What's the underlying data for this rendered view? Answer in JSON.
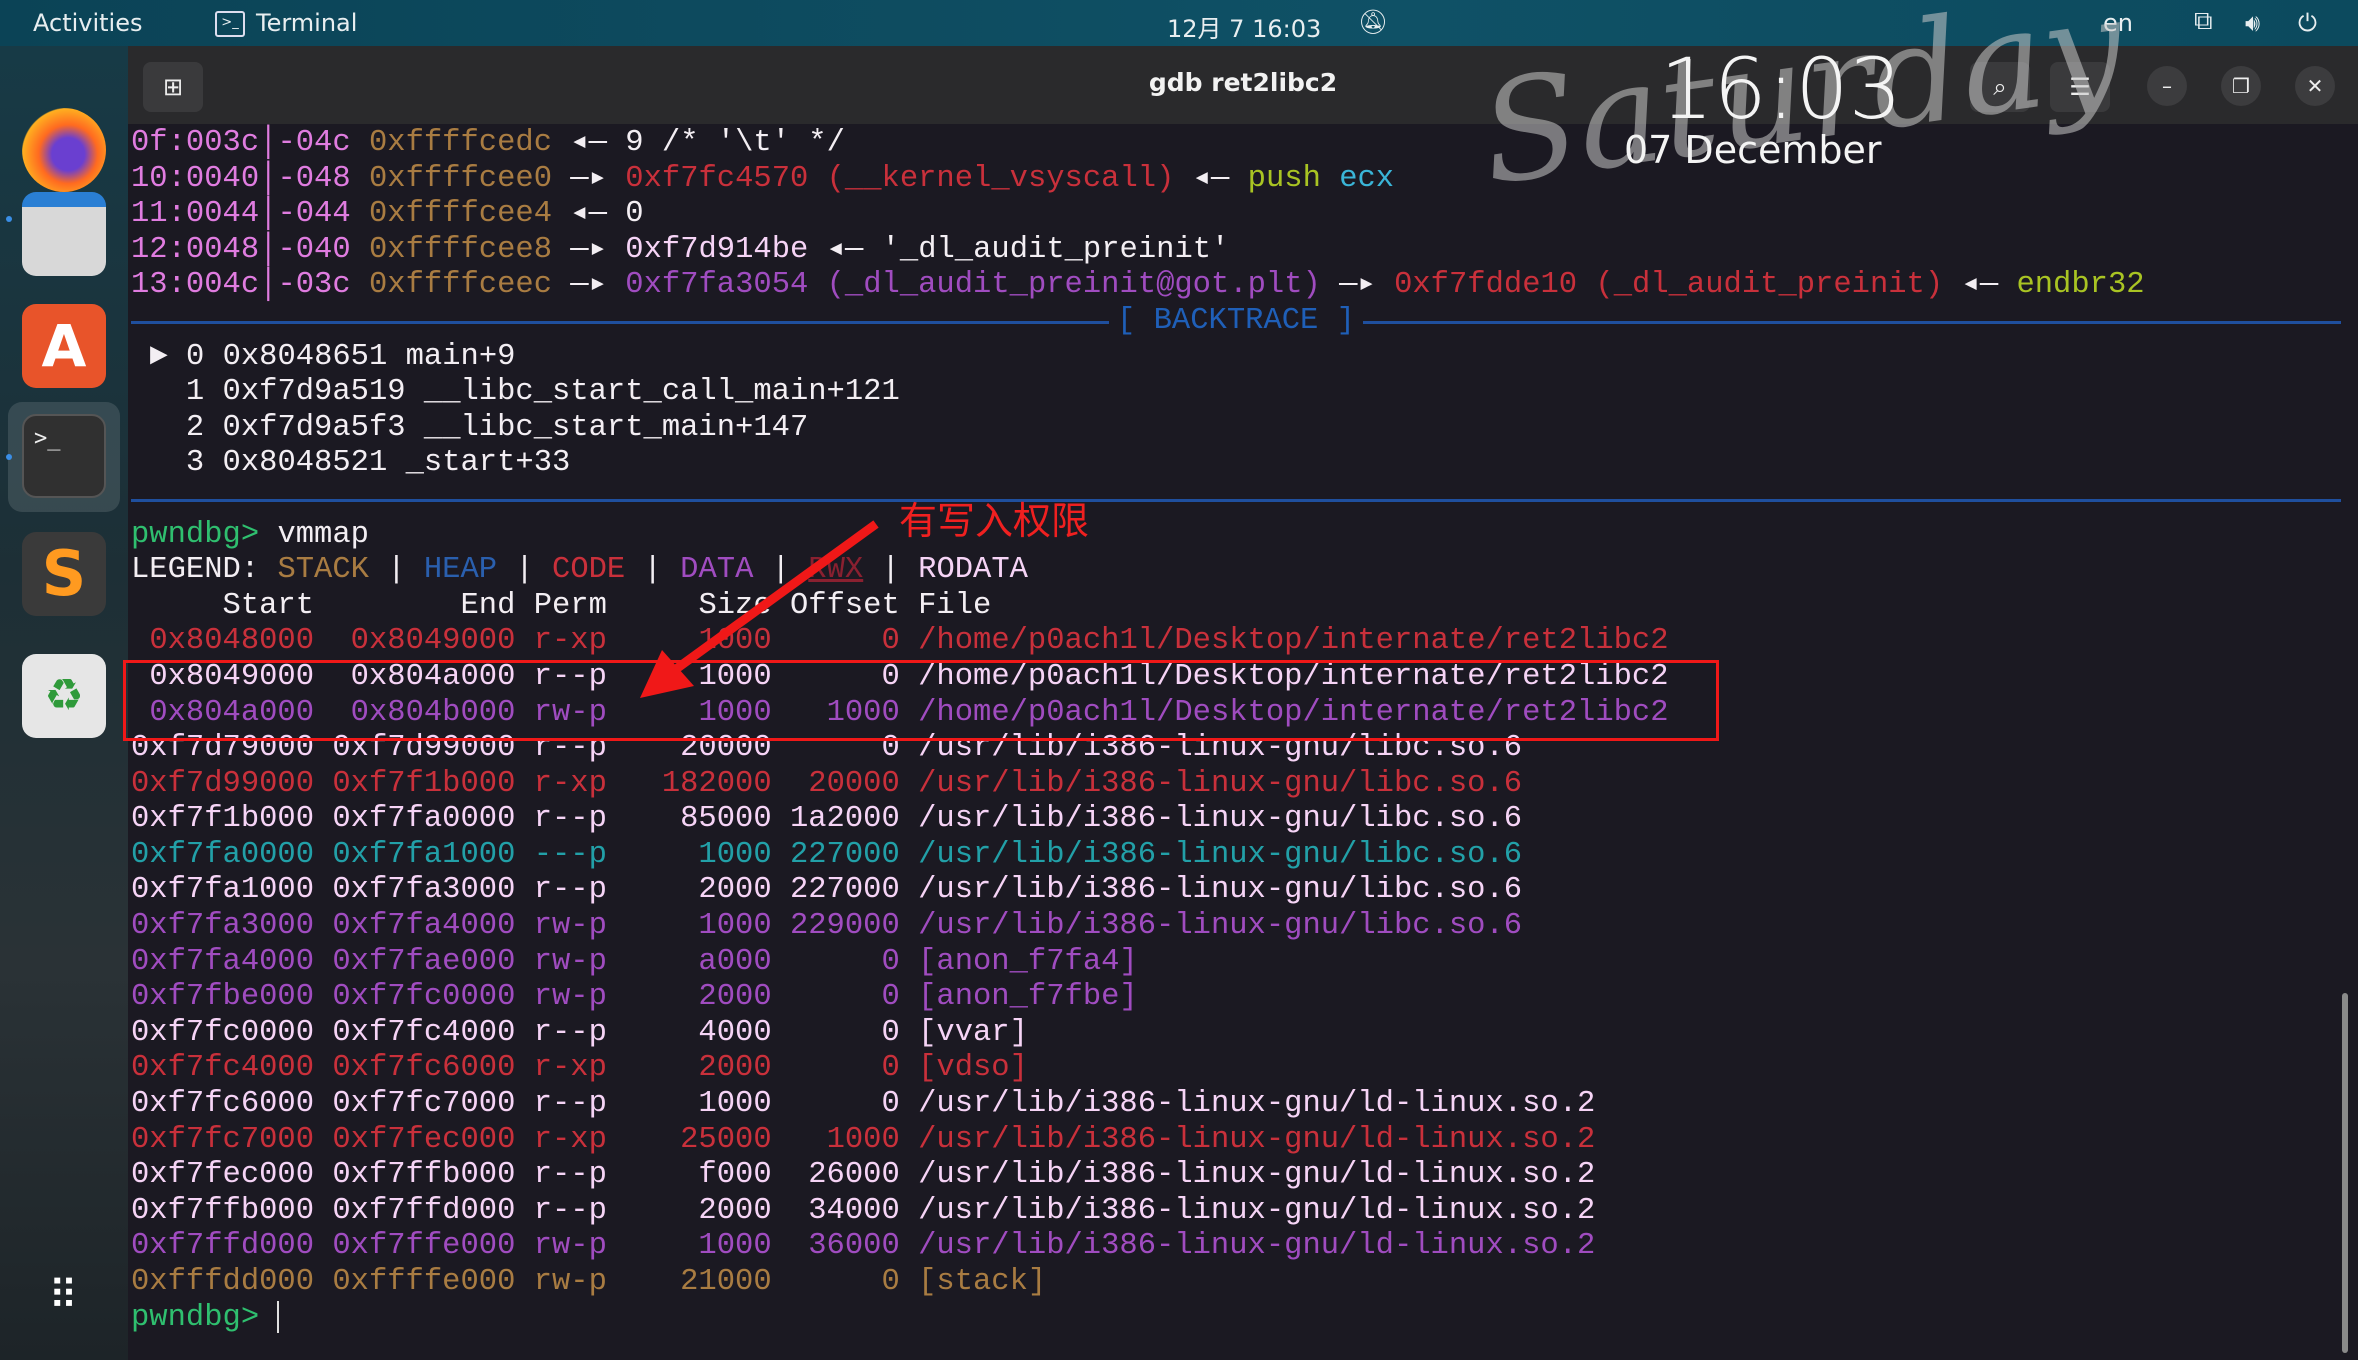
{
  "topbar": {
    "activities": "Activities",
    "app": "Terminal",
    "clock": "12月 7 16:03",
    "lang": "en"
  },
  "window": {
    "title": "gdb ret2libc2"
  },
  "wallpaper": {
    "day": "Saturday",
    "time": "16:03",
    "date": "07 December"
  },
  "colors": {
    "stack": "#a97c42",
    "heap": "#2a5fae",
    "code": "#c9303b",
    "data": "#a04cc0",
    "rodata": "#f6d4f6",
    "prompt": "#2fbf6f",
    "annotation": "#f02020"
  },
  "telescope": [
    [
      [
        "0f:003c",
        "idx"
      ],
      [
        "│",
        "idx"
      ],
      [
        "-04c",
        "idx"
      ],
      [
        " ",
        "w"
      ],
      [
        "0xffffcedc",
        "stack"
      ],
      [
        " ◂— ",
        "w"
      ],
      [
        "9 /* '\\t' */",
        "w"
      ]
    ],
    [
      [
        "10:0040",
        "idx"
      ],
      [
        "│",
        "idx"
      ],
      [
        "-048",
        "idx"
      ],
      [
        " ",
        "w"
      ],
      [
        "0xffffcee0",
        "stack"
      ],
      [
        " —▸ ",
        "w"
      ],
      [
        "0xf7fc4570 (__kernel_vsyscall)",
        "code"
      ],
      [
        " ◂— ",
        "w"
      ],
      [
        "push",
        "yg"
      ],
      [
        " ",
        "w"
      ],
      [
        "ecx",
        "cyan"
      ]
    ],
    [
      [
        "11:0044",
        "idx"
      ],
      [
        "│",
        "idx"
      ],
      [
        "-044",
        "idx"
      ],
      [
        " ",
        "w"
      ],
      [
        "0xffffcee4",
        "stack"
      ],
      [
        " ◂— ",
        "w"
      ],
      [
        "0",
        "w"
      ]
    ],
    [
      [
        "12:0048",
        "idx"
      ],
      [
        "│",
        "idx"
      ],
      [
        "-040",
        "idx"
      ],
      [
        " ",
        "w"
      ],
      [
        "0xffffcee8",
        "stack"
      ],
      [
        " —▸ ",
        "w"
      ],
      [
        "0xf7d914be",
        "rodata"
      ],
      [
        " ◂— ",
        "w"
      ],
      [
        "'_dl_audit_preinit'",
        "w"
      ]
    ],
    [
      [
        "13:004c",
        "idx"
      ],
      [
        "│",
        "idx"
      ],
      [
        "-03c",
        "idx"
      ],
      [
        " ",
        "w"
      ],
      [
        "0xffffceec",
        "stack"
      ],
      [
        " —▸ ",
        "w"
      ],
      [
        "0xf7fa3054 (_dl_audit_preinit@got.plt)",
        "data"
      ],
      [
        " —▸ ",
        "w"
      ],
      [
        "0xf7fdde10 (_dl_audit_preinit)",
        "code"
      ],
      [
        " ◂— ",
        "w"
      ],
      [
        "endbr32",
        "yg"
      ]
    ]
  ],
  "backtrace": {
    "title": "[ BACKTRACE ]",
    "frames": [
      {
        "marker": "►",
        "index": "0",
        "addr": "0x8048651",
        "symbol": "main+9"
      },
      {
        "marker": "",
        "index": "1",
        "addr": "0xf7d9a519",
        "symbol": "__libc_start_call_main+121"
      },
      {
        "marker": "",
        "index": "2",
        "addr": "0xf7d9a5f3",
        "symbol": "__libc_start_main+147"
      },
      {
        "marker": "",
        "index": "3",
        "addr": "0x8048521",
        "symbol": "_start+33"
      }
    ]
  },
  "vmmap": {
    "prompt": "pwndbg>",
    "command": "vmmap",
    "legend": {
      "label": "LEGEND:",
      "items": [
        [
          "STACK",
          "stack"
        ],
        [
          "HEAP",
          "heap"
        ],
        [
          "CODE",
          "code"
        ],
        [
          "DATA",
          "data"
        ],
        [
          "RWX",
          "rwx"
        ],
        [
          "RODATA",
          "rodata"
        ]
      ]
    },
    "headers": {
      "start": "Start",
      "end": "End",
      "perm": "Perm",
      "size": "Size",
      "offset": "Offset",
      "file": "File"
    },
    "rows": [
      {
        "start": "0x8048000",
        "end": "0x8049000",
        "perm": "r-xp",
        "size": "1000",
        "offset": "0",
        "file": "/home/p0ach1l/Desktop/internate/ret2libc2",
        "type": "code"
      },
      {
        "start": "0x8049000",
        "end": "0x804a000",
        "perm": "r--p",
        "size": "1000",
        "offset": "0",
        "file": "/home/p0ach1l/Desktop/internate/ret2libc2",
        "type": "rodata"
      },
      {
        "start": "0x804a000",
        "end": "0x804b000",
        "perm": "rw-p",
        "size": "1000",
        "offset": "1000",
        "file": "/home/p0ach1l/Desktop/internate/ret2libc2",
        "type": "data"
      },
      {
        "start": "0xf7d79000",
        "end": "0xf7d99000",
        "perm": "r--p",
        "size": "20000",
        "offset": "0",
        "file": "/usr/lib/i386-linux-gnu/libc.so.6",
        "type": "rodata"
      },
      {
        "start": "0xf7d99000",
        "end": "0xf7f1b000",
        "perm": "r-xp",
        "size": "182000",
        "offset": "20000",
        "file": "/usr/lib/i386-linux-gnu/libc.so.6",
        "type": "code"
      },
      {
        "start": "0xf7f1b000",
        "end": "0xf7fa0000",
        "perm": "r--p",
        "size": "85000",
        "offset": "1a2000",
        "file": "/usr/lib/i386-linux-gnu/libc.so.6",
        "type": "rodata"
      },
      {
        "start": "0xf7fa0000",
        "end": "0xf7fa1000",
        "perm": "---p",
        "size": "1000",
        "offset": "227000",
        "file": "/usr/lib/i386-linux-gnu/libc.so.6",
        "type": "none"
      },
      {
        "start": "0xf7fa1000",
        "end": "0xf7fa3000",
        "perm": "r--p",
        "size": "2000",
        "offset": "227000",
        "file": "/usr/lib/i386-linux-gnu/libc.so.6",
        "type": "rodata"
      },
      {
        "start": "0xf7fa3000",
        "end": "0xf7fa4000",
        "perm": "rw-p",
        "size": "1000",
        "offset": "229000",
        "file": "/usr/lib/i386-linux-gnu/libc.so.6",
        "type": "data"
      },
      {
        "start": "0xf7fa4000",
        "end": "0xf7fae000",
        "perm": "rw-p",
        "size": "a000",
        "offset": "0",
        "file": "[anon_f7fa4]",
        "type": "data"
      },
      {
        "start": "0xf7fbe000",
        "end": "0xf7fc0000",
        "perm": "rw-p",
        "size": "2000",
        "offset": "0",
        "file": "[anon_f7fbe]",
        "type": "data"
      },
      {
        "start": "0xf7fc0000",
        "end": "0xf7fc4000",
        "perm": "r--p",
        "size": "4000",
        "offset": "0",
        "file": "[vvar]",
        "type": "rodata"
      },
      {
        "start": "0xf7fc4000",
        "end": "0xf7fc6000",
        "perm": "r-xp",
        "size": "2000",
        "offset": "0",
        "file": "[vdso]",
        "type": "code"
      },
      {
        "start": "0xf7fc6000",
        "end": "0xf7fc7000",
        "perm": "r--p",
        "size": "1000",
        "offset": "0",
        "file": "/usr/lib/i386-linux-gnu/ld-linux.so.2",
        "type": "rodata"
      },
      {
        "start": "0xf7fc7000",
        "end": "0xf7fec000",
        "perm": "r-xp",
        "size": "25000",
        "offset": "1000",
        "file": "/usr/lib/i386-linux-gnu/ld-linux.so.2",
        "type": "code"
      },
      {
        "start": "0xf7fec000",
        "end": "0xf7ffb000",
        "perm": "r--p",
        "size": "f000",
        "offset": "26000",
        "file": "/usr/lib/i386-linux-gnu/ld-linux.so.2",
        "type": "rodata"
      },
      {
        "start": "0xf7ffb000",
        "end": "0xf7ffd000",
        "perm": "r--p",
        "size": "2000",
        "offset": "34000",
        "file": "/usr/lib/i386-linux-gnu/ld-linux.so.2",
        "type": "rodata"
      },
      {
        "start": "0xf7ffd000",
        "end": "0xf7ffe000",
        "perm": "rw-p",
        "size": "1000",
        "offset": "36000",
        "file": "/usr/lib/i386-linux-gnu/ld-linux.so.2",
        "type": "data"
      },
      {
        "start": "0xfffdd000",
        "end": "0xffffe000",
        "perm": "rw-p",
        "size": "21000",
        "offset": "0",
        "file": "[stack]",
        "type": "stack"
      }
    ]
  },
  "annotation": "有写入权限"
}
